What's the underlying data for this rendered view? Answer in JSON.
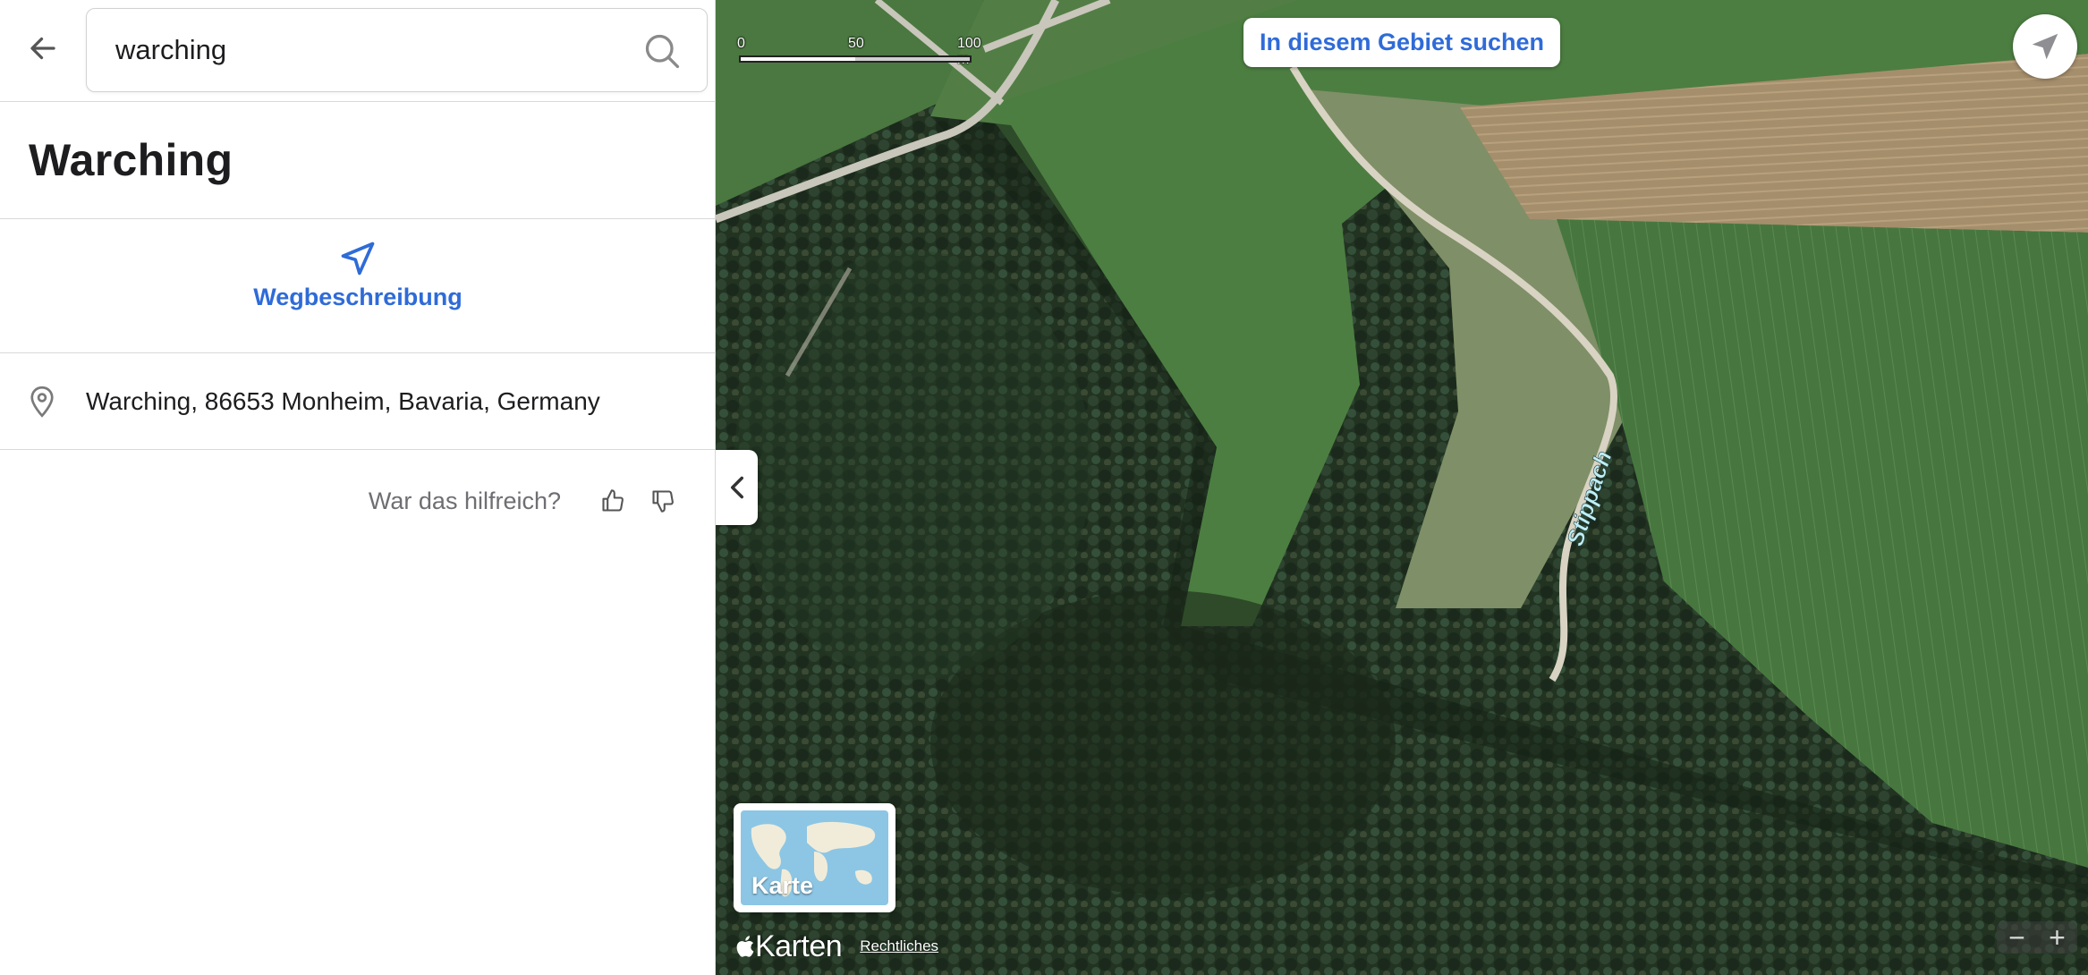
{
  "search": {
    "value": "warching",
    "back_icon": "arrow-left-icon",
    "search_icon": "magnifier-icon"
  },
  "place": {
    "title": "Warching",
    "address": "Warching, 86653 Monheim, Bavaria, Germany"
  },
  "actions": {
    "directions_label": "Wegbeschreibung",
    "directions_icon": "navigation-arrow-icon"
  },
  "feedback": {
    "label": "War das hilfreich?",
    "up_icon": "thumbs-up-icon",
    "down_icon": "thumbs-down-icon"
  },
  "map": {
    "search_area_label": "In diesem Gebiet suchen",
    "scale": {
      "labels": [
        "0",
        "50",
        "100 m"
      ]
    },
    "road_label": "Stippach",
    "map_type_label": "Karte",
    "brand": "Karten",
    "legal_label": "Rechtliches",
    "zoom_out": "−",
    "zoom_in": "+",
    "locate_icon": "location-arrow-icon",
    "collapse_icon": "chevron-left-icon"
  },
  "colors": {
    "accent": "#2f6bd8",
    "text": "#1d1d1f",
    "muted": "#6e6e73"
  }
}
